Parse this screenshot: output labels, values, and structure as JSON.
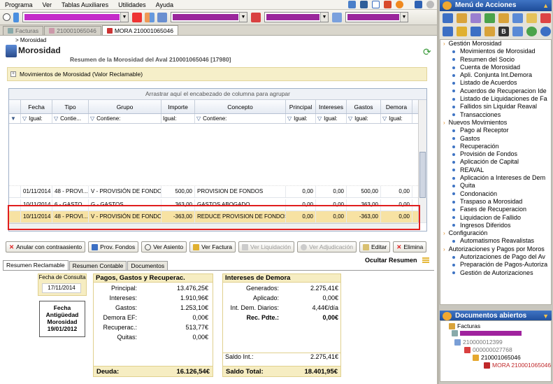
{
  "menu": {
    "items": [
      "Programa",
      "Ver",
      "Tablas Auxiliares",
      "Utilidades",
      "Ayuda"
    ]
  },
  "tabs": [
    {
      "label": "Facturas",
      "active": false
    },
    {
      "label": "210001065046",
      "active": false
    },
    {
      "label": "MORA 210001065046",
      "active": true
    }
  ],
  "breadcrumb": "> Morosidad",
  "page": {
    "title": "Morosidad",
    "subtitle": "Resumen de la Morosidad del Aval 210001065046 [17980]",
    "section": "Movimientos de Morosidad (Valor Reclamable)"
  },
  "grid": {
    "group_hint": "Arrastrar aquí el encabezado de columna para agrupar",
    "columns": [
      "Fecha",
      "Tipo",
      "Grupo",
      "Importe",
      "Concepto",
      "Principal",
      "Intereses",
      "Gastos",
      "Demora"
    ],
    "filters": [
      "Igual:",
      "Contie...",
      "Contiene:",
      "Igual:",
      "Contiene:",
      "Igual:",
      "Igual:",
      "Igual:",
      "Igual:"
    ],
    "rows": [
      {
        "fecha": "01/11/2014",
        "tipo": "48 - PROVI...",
        "grupo": "V - PROVISIÓN DE FONDOS",
        "importe": "500,00",
        "concepto": "PROVISION DE FONDOS",
        "principal": "0,00",
        "intereses": "0,00",
        "gastos": "500,00",
        "demora": "0,00"
      },
      {
        "fecha": "10/11/2014",
        "tipo": "6 - GASTO...",
        "grupo": "G - GASTOS",
        "importe": "363,00",
        "concepto": "GASTOS ABOGADO",
        "principal": "0,00",
        "intereses": "0,00",
        "gastos": "363,00",
        "demora": "0,00"
      },
      {
        "fecha": "10/11/2014",
        "tipo": "48 - PROVI...",
        "grupo": "V - PROVISIÓN DE FONDOS",
        "importe": "-363,00",
        "concepto": "REDUCE PROVISION DE FONDOS",
        "principal": "0,00",
        "intereses": "0,00",
        "gastos": "-363,00",
        "demora": "0,00"
      }
    ]
  },
  "buttons": {
    "anular": "Anular con contraasiento",
    "prov": "Prov. Fondos",
    "ver_asiento": "Ver Asiento",
    "ver_factura": "Ver Factura",
    "ver_liquidacion": "Ver Liquidación",
    "ver_adjudicacion": "Ver Adjudicación",
    "editar": "Editar",
    "eliminar": "Elimina"
  },
  "bottom_tabs": [
    "Resumen Reclamable",
    "Resumen Contable",
    "Documentos"
  ],
  "ocultar": "Ocultar Resumen",
  "resumen": {
    "fecha_consulta_label": "Fecha de Consulta",
    "fecha_consulta": "17/11/2014",
    "antig_l1": "Fecha",
    "antig_l2": "Antigüedad",
    "antig_l3": "Morosidad",
    "antig_date": "19/01/2012",
    "pagos_title": "Pagos, Gastos y Recuperac.",
    "pagos": [
      {
        "k": "Principal:",
        "v": "13.476,25€"
      },
      {
        "k": "Intereses:",
        "v": "1.910,96€"
      },
      {
        "k": "Gastos:",
        "v": "1.253,10€"
      },
      {
        "k": "Demora EF:",
        "v": "0,00€"
      },
      {
        "k": "Recuperac.:",
        "v": "513,77€"
      },
      {
        "k": "Quitas:",
        "v": "0,00€"
      }
    ],
    "intereses_title": "Intereses de Demora",
    "intereses": [
      {
        "k": "Generados:",
        "v": "2.275,41€"
      },
      {
        "k": "Aplicado:",
        "v": "0,00€"
      },
      {
        "k": "Int. Dem. Diarios:",
        "v": "4,44€/día"
      },
      {
        "k": "Rec. Pdte.:",
        "v": "0,00€"
      }
    ],
    "saldo_int_label": "Saldo Int.:",
    "saldo_int": "2.275,41€",
    "deuda_label": "Deuda:",
    "deuda": "16.126,54€",
    "saldo_total_label": "Saldo Total:",
    "saldo_total": "18.401,95€"
  },
  "panel": {
    "title": "Menú de Acciones",
    "sections": [
      {
        "title": "Gestión Morosidad",
        "items": [
          "Movimientos de Morosidad",
          "Resumen del Socio",
          "Cuenta de Morosidad",
          "Apli. Conjunta Int.Demora",
          "Listado de Acuerdos",
          "Acuerdos de Recuperacion Ide",
          "Listado de Liquidaciones de Fa",
          "Fallidos sin Liquidar Reaval",
          "Transacciones"
        ]
      },
      {
        "title": "Nuevos Movimientos",
        "items": [
          "Pago al Receptor",
          "Gastos",
          "Recuperación",
          "Provisión de Fondos",
          "Aplicación de Capital",
          "REAVAL",
          "Aplicación a Intereses de Dem",
          "Quita",
          "Condonación",
          "Traspaso a Morosidad",
          "Fases de Recuperacion",
          "Liquidacion de Fallido",
          "Ingresos Diferidos"
        ]
      },
      {
        "title": "Configuración",
        "items": [
          "Automatismos Reavalistas"
        ]
      },
      {
        "title": "Autorizaciones y Pagos por Moros",
        "items": [
          "Autorizaciones de Pago del Av",
          "Preparación de Pagos-Autoriza",
          "Gestión de Autorizaciones"
        ]
      }
    ],
    "docs_title": "Documentos abiertos",
    "docs": [
      "Facturas",
      "210000012399",
      "000000027768",
      "210001065046",
      "MORA 210001065046"
    ]
  }
}
